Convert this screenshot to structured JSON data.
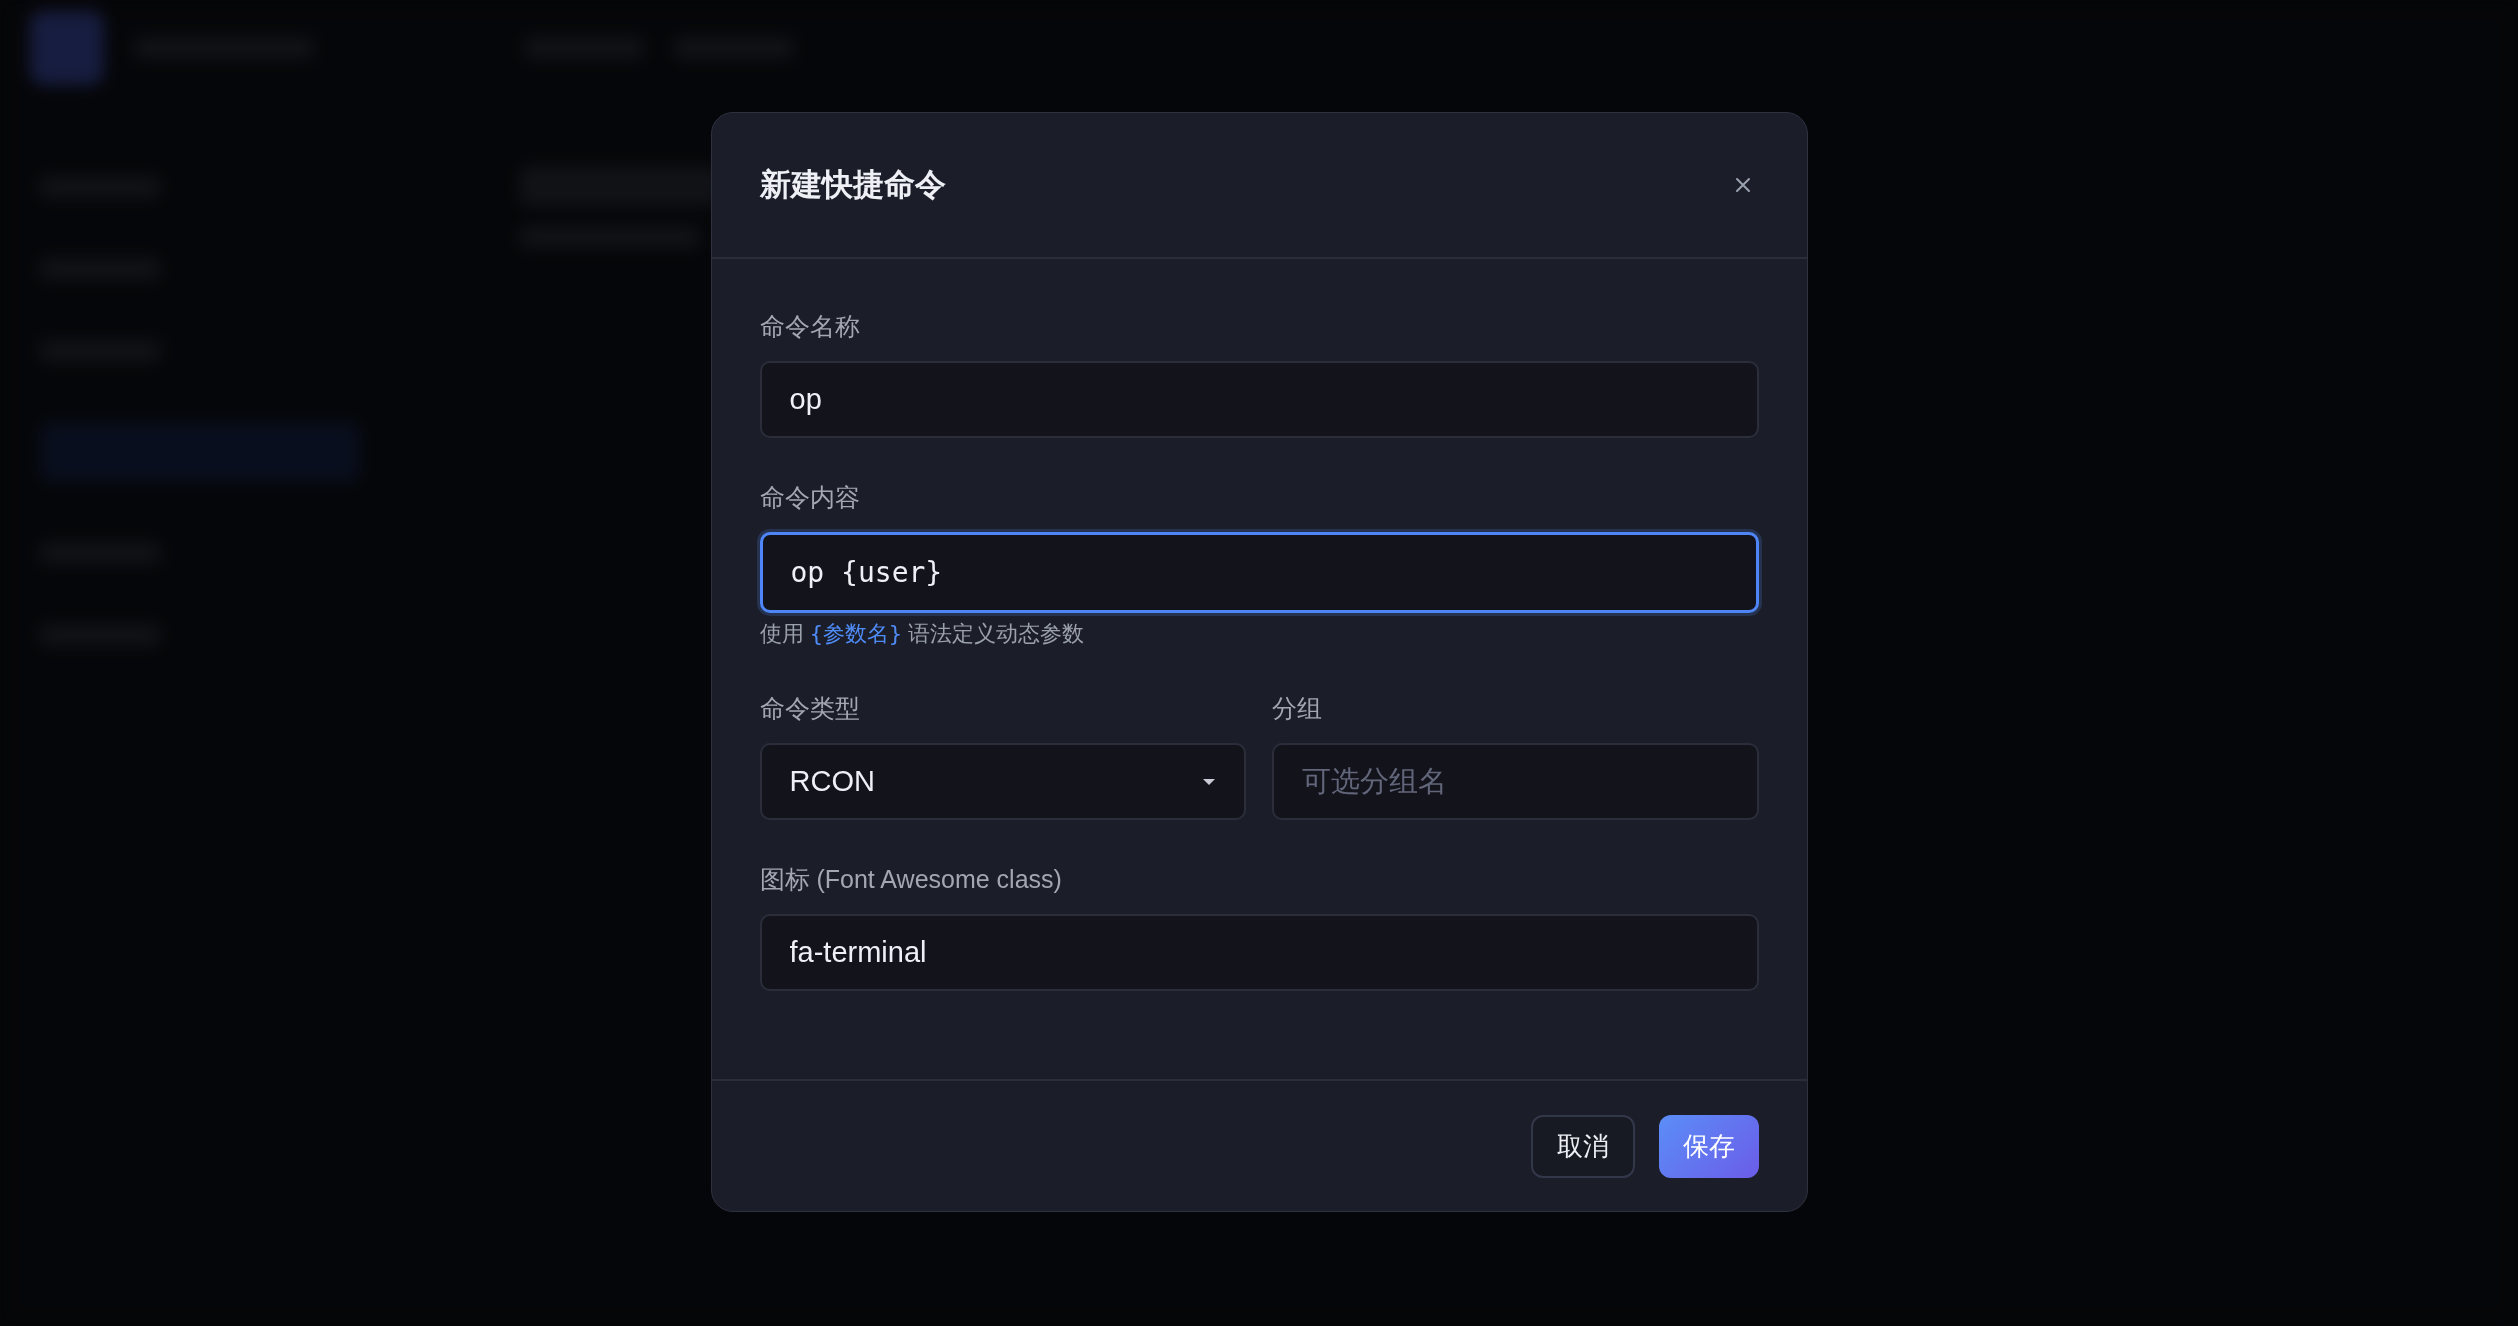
{
  "dialog": {
    "title": "新建快捷命令",
    "rows": [
      [
        {
          "kind": "text",
          "label": "命令名称",
          "value": "op",
          "focused": false
        }
      ],
      [
        {
          "kind": "code",
          "label": "命令内容",
          "value": "op {user}",
          "focused": true,
          "hint": {
            "before": "使用",
            "param": "{参数名}",
            "after": "语法定义动态参数"
          }
        }
      ],
      [
        {
          "kind": "select",
          "label": "命令类型",
          "value": "RCON",
          "focused": false
        },
        {
          "kind": "text",
          "label": "分组",
          "placeholder": "可选分组名",
          "focused": false
        }
      ],
      [
        {
          "kind": "text",
          "label": "图标 (Font Awesome class)",
          "value": "fa-terminal",
          "focused": false
        }
      ]
    ],
    "buttons": [
      {
        "label": "取消",
        "kind": "secondary"
      },
      {
        "label": "保存",
        "kind": "primary"
      }
    ]
  }
}
